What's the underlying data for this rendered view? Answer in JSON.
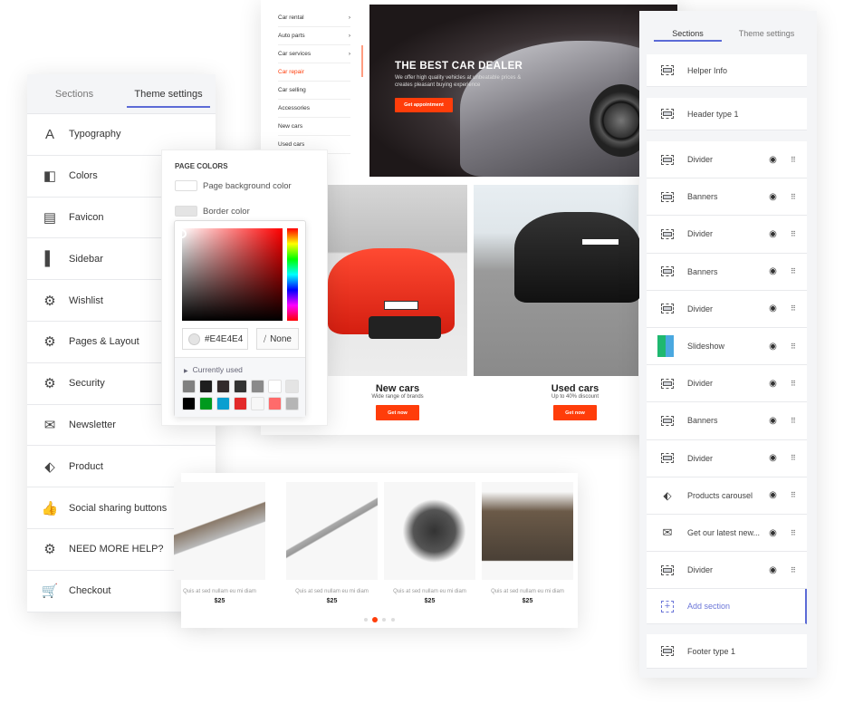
{
  "left_panel": {
    "tabs": [
      {
        "label": "Sections"
      },
      {
        "label": "Theme settings",
        "active": true
      }
    ],
    "items": [
      {
        "label": "Typography",
        "icon": "typography-icon"
      },
      {
        "label": "Colors",
        "icon": "colors-icon"
      },
      {
        "label": "Favicon",
        "icon": "favicon-icon"
      },
      {
        "label": "Sidebar",
        "icon": "sidebar-icon"
      },
      {
        "label": "Wishlist",
        "icon": "gear-icon"
      },
      {
        "label": "Pages & Layout",
        "icon": "gear-icon"
      },
      {
        "label": "Security",
        "icon": "gear-icon"
      },
      {
        "label": "Newsletter",
        "icon": "mail-icon"
      },
      {
        "label": "Product",
        "icon": "tag-icon"
      },
      {
        "label": "Social sharing buttons",
        "icon": "thumbs-up-icon"
      },
      {
        "label": "NEED MORE HELP?",
        "icon": "gear-icon"
      },
      {
        "label": "Checkout",
        "icon": "cart-icon"
      }
    ]
  },
  "colors_panel": {
    "title": "PAGE COLORS",
    "page_background_label": "Page background color",
    "border_label": "Border color",
    "picker": {
      "hex_value": "#E4E4E4",
      "none_label": "None",
      "currently_used_label": "Currently used",
      "swatches": [
        "#808080",
        "#1e1e1e",
        "#332b2b",
        "#333333",
        "#8a8a8a",
        "#ffffff",
        "#e4e4e4",
        "#000000",
        "#009a1e",
        "#0a9fd0",
        "#e32a2a",
        "#f7f7f7",
        "#ff6b6b",
        "#b5b5b5"
      ]
    }
  },
  "site": {
    "menu": [
      "Car rental",
      "Auto parts",
      "Car services",
      "Car repair",
      "Car selling",
      "Accessories",
      "New cars",
      "Used cars"
    ],
    "menu_active": "Car repair",
    "hero": {
      "title": "THE BEST CAR DEALER",
      "subtitle": "We offer high quality vehicles at unbeatable prices & creates pleasant buying experience",
      "button": "Get appointment"
    },
    "banners": [
      {
        "title": "New cars",
        "subtitle": "Wide range of brands",
        "button": "Get now"
      },
      {
        "title": "Used cars",
        "subtitle": "Up to 40% discount",
        "button": "Get now"
      }
    ],
    "accent": "#ff3d0a"
  },
  "products": {
    "items": [
      {
        "title": "Quis at sed nullam eu mi diam",
        "price": "$25"
      },
      {
        "title": "Quis at sed nullam eu mi diam",
        "price": "$25"
      },
      {
        "title": "Quis at sed nullam eu mi diam",
        "price": "$25"
      },
      {
        "title": "Quis at sed nullam eu mi diam",
        "price": "$25"
      }
    ],
    "active_page": 2,
    "pages": 4
  },
  "right_panel": {
    "tabs": [
      {
        "label": "Sections",
        "active": true
      },
      {
        "label": "Theme settings"
      }
    ],
    "fixed_top": [
      {
        "label": "Helper Info"
      },
      {
        "label": "Header type 1"
      }
    ],
    "sections": [
      {
        "label": "Divider"
      },
      {
        "label": "Banners"
      },
      {
        "label": "Divider"
      },
      {
        "label": "Banners"
      },
      {
        "label": "Divider"
      },
      {
        "label": "Slideshow"
      },
      {
        "label": "Divider"
      },
      {
        "label": "Banners"
      },
      {
        "label": "Divider"
      },
      {
        "label": "Products carousel"
      },
      {
        "label": "Get our latest new..."
      },
      {
        "label": "Divider"
      }
    ],
    "add_section": "Add section",
    "footer": "Footer type 1",
    "accent": "#5c6bd6"
  }
}
